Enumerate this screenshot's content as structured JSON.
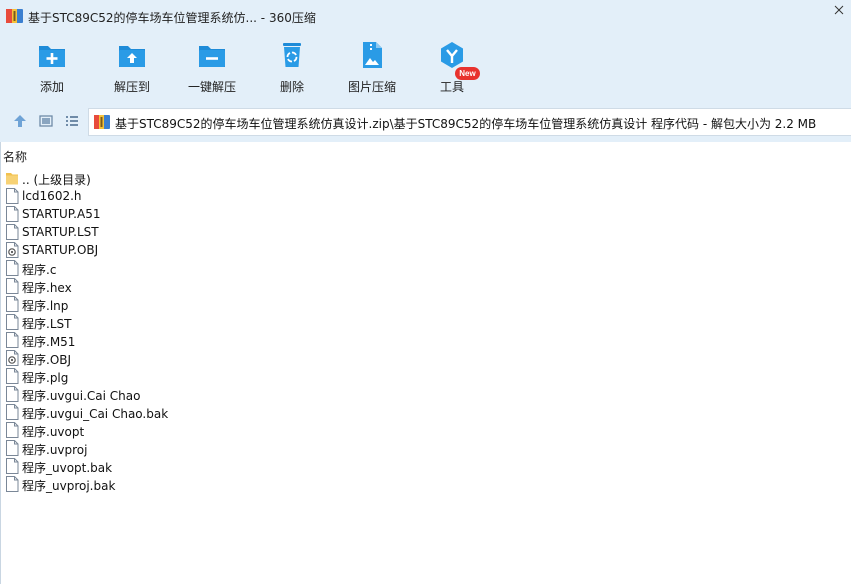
{
  "window": {
    "title": "基于STC89C52的停车场车位管理系统仿... - 360压缩"
  },
  "toolbar": {
    "items": [
      {
        "label": "添加",
        "icon": "add-icon"
      },
      {
        "label": "解压到",
        "icon": "extract-to-icon"
      },
      {
        "label": "一键解压",
        "icon": "one-click-extract-icon"
      },
      {
        "label": "删除",
        "icon": "delete-icon"
      },
      {
        "label": "图片压缩",
        "icon": "image-compress-icon"
      },
      {
        "label": "工具",
        "icon": "tools-icon",
        "badge": "New"
      }
    ]
  },
  "address": {
    "path": "基于STC89C52的停车场车位管理系统仿真设计.zip\\基于STC89C52的停车场车位管理系统仿真设计 程序代码 - 解包大小为 2.2 MB"
  },
  "list": {
    "column_header": "名称",
    "files": [
      {
        "name": ".. (上级目录)",
        "icon": "folder-icon"
      },
      {
        "name": "lcd1602.h",
        "icon": "file-icon"
      },
      {
        "name": "STARTUP.A51",
        "icon": "file-icon"
      },
      {
        "name": "STARTUP.LST",
        "icon": "file-icon"
      },
      {
        "name": "STARTUP.OBJ",
        "icon": "object-file-icon"
      },
      {
        "name": "程序.c",
        "icon": "file-icon"
      },
      {
        "name": "程序.hex",
        "icon": "file-icon"
      },
      {
        "name": "程序.lnp",
        "icon": "file-icon"
      },
      {
        "name": "程序.LST",
        "icon": "file-icon"
      },
      {
        "name": "程序.M51",
        "icon": "file-icon"
      },
      {
        "name": "程序.OBJ",
        "icon": "object-file-icon"
      },
      {
        "name": "程序.plg",
        "icon": "file-icon"
      },
      {
        "name": "程序.uvgui.Cai Chao",
        "icon": "file-icon"
      },
      {
        "name": "程序.uvgui_Cai Chao.bak",
        "icon": "file-icon"
      },
      {
        "name": "程序.uvopt",
        "icon": "file-icon"
      },
      {
        "name": "程序.uvproj",
        "icon": "file-icon"
      },
      {
        "name": "程序_uvopt.bak",
        "icon": "file-icon"
      },
      {
        "name": "程序_uvproj.bak",
        "icon": "file-icon"
      }
    ]
  },
  "colors": {
    "chrome_bg": "#e3eff9",
    "icon_blue": "#1e8bd8",
    "badge_red": "#e8322e"
  }
}
